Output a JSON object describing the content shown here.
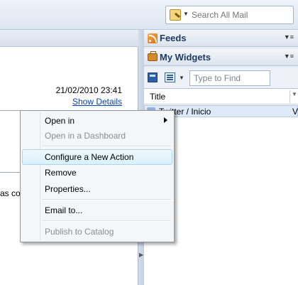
{
  "search": {
    "placeholder": "Search All Mail"
  },
  "mail": {
    "date": "21/02/2010 23:41",
    "show_details": "Show Details",
    "body_fragment": "as co"
  },
  "feeds": {
    "title": "Feeds"
  },
  "widgets": {
    "title": "My Widgets",
    "find_placeholder": "Type to Find",
    "column_title": "Title",
    "rows": [
      {
        "title": "Twitter / Inicio",
        "col2": "V"
      }
    ]
  },
  "context_menu": {
    "items": [
      {
        "label": "Open in",
        "submenu": true,
        "enabled": true
      },
      {
        "label": "Open in a Dashboard",
        "enabled": false
      },
      {
        "label": "Configure a New Action",
        "enabled": true,
        "highlighted": true
      },
      {
        "label": "Remove",
        "enabled": true
      },
      {
        "label": "Properties...",
        "enabled": true
      },
      {
        "label": "Email to...",
        "enabled": true
      },
      {
        "label": "Publish to Catalog",
        "enabled": false
      }
    ]
  },
  "colors": {
    "accent": "#1f3b63",
    "link": "#0645ad",
    "highlight": "#d9f0fa"
  }
}
